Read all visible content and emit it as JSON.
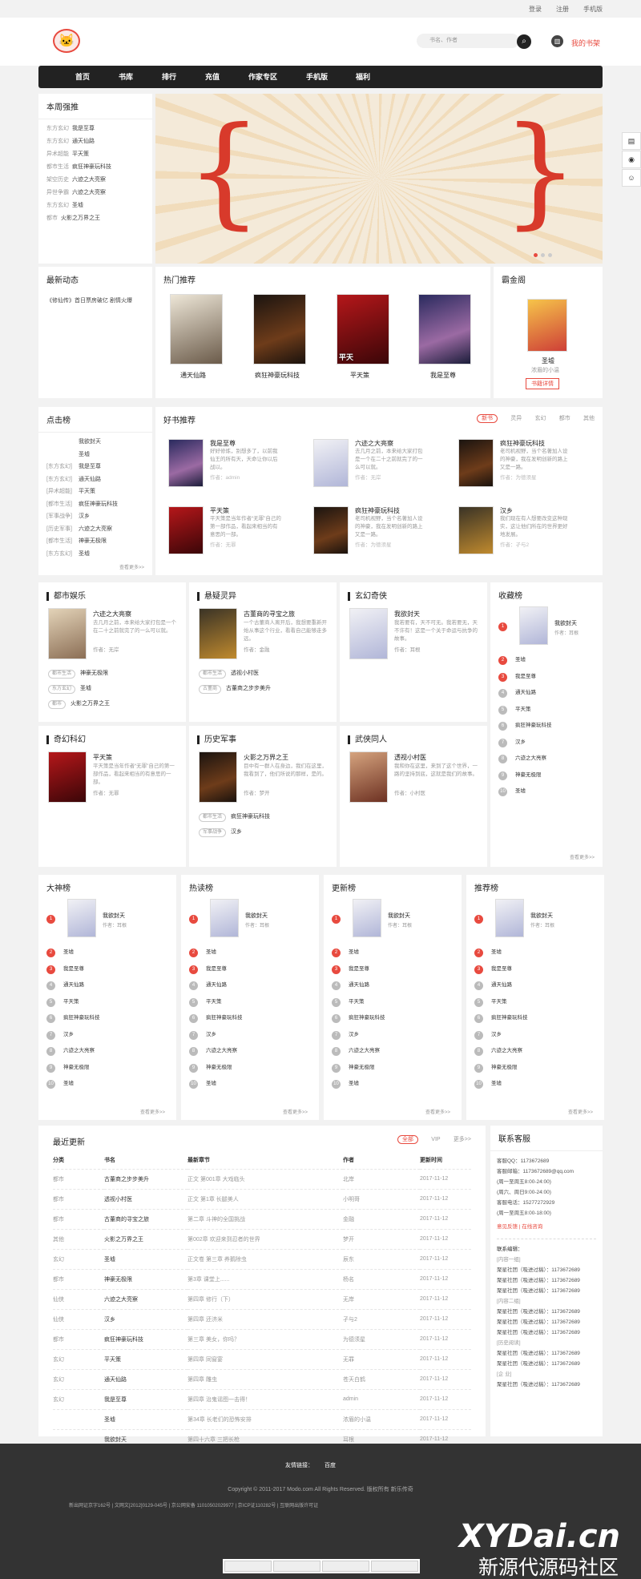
{
  "topbar": {
    "login": "登录",
    "register": "注册",
    "mobile": "手机版"
  },
  "header": {
    "search_placeholder": "书名、作者",
    "shelf": "我的书架"
  },
  "nav": [
    "首页",
    "书库",
    "排行",
    "充值",
    "作家专区",
    "手机版",
    "福利"
  ],
  "weekly": {
    "title": "本周强推",
    "items": [
      {
        "cat": "东方玄幻",
        "name": "我是至尊"
      },
      {
        "cat": "东方玄幻",
        "name": "通天仙路"
      },
      {
        "cat": "异术超能",
        "name": "平天策"
      },
      {
        "cat": "都市生活",
        "name": "疯狂神豪玩科技"
      },
      {
        "cat": "架空历史",
        "name": "六迹之大亮察"
      },
      {
        "cat": "异世争霸",
        "name": "六迹之大亮察"
      },
      {
        "cat": "东方玄幻",
        "name": "圣墟"
      },
      {
        "cat": "都市",
        "name": "火影之万界之王"
      }
    ]
  },
  "news": {
    "title": "最新动态",
    "items": [
      "《修仙传》首日票房破亿 剧情火爆"
    ]
  },
  "hot": {
    "title": "热门推荐",
    "books": [
      "通天仙路",
      "疯狂神豪玩科技",
      "平天策",
      "我是至尊"
    ]
  },
  "must": {
    "title": "霸金阁",
    "book": "圣墟",
    "sub": "浓眉的小温",
    "btn": "书籍详情"
  },
  "click": {
    "title": "点击榜",
    "items": [
      "我欲封天",
      "圣墟",
      "我是至尊",
      "通天仙路",
      "平天策",
      "疯狂神豪玩科技",
      "汉乡",
      "六迹之大亮察",
      "神豪无极限",
      "圣墟"
    ],
    "cats": [
      "",
      "",
      "[东方玄幻]",
      "[东方玄幻]",
      "[异术超能]",
      "[都市生活]",
      "[军事战争]",
      "[历史军事]",
      "[都市生活]",
      "[东方玄幻]"
    ],
    "more": "查看更多>>"
  },
  "good": {
    "title": "好书推荐",
    "tabs": [
      "新书",
      "灵异",
      "玄幻",
      "都市",
      "其他"
    ],
    "books": [
      {
        "name": "我是至尊",
        "desc": "好好修炼，别想多了，以前我仙王的所有天，天命让你以后战以。",
        "author": "作者：admin"
      },
      {
        "name": "六迹之大亮察",
        "desc": "去几月之前，本来给大家打包是一个在二十之前就完了的一么可以就。",
        "author": "作者：无岸"
      },
      {
        "name": "疯狂神豪玩科技",
        "desc": "老司机视野，当个名著加人设的神豪，我在发明创新的路上又是一路。",
        "author": "作者：为德须星"
      },
      {
        "name": "平天策",
        "desc": "平天策是当年作者“无罪”自己的第一部作品，看起来相当的有意思的一部。",
        "author": "作者：无罪"
      },
      {
        "name": "疯狂神豪玩科技",
        "desc": "老司机视野，当个名著加人设的神豪，我在发明创新的路上又是一路。",
        "author": "作者：为德须星"
      },
      {
        "name": "汉乡",
        "desc": "我们现在有人想要改变这种现实，这让他们所在的世界更好地发展。",
        "author": "作者：孑与2"
      }
    ]
  },
  "cats": [
    {
      "title": "都市娱乐",
      "book": "六迹之大亮察",
      "desc": "去几月之前，本来给大家打包是一个在二十之前就完了的一么可以就。",
      "author": "作者：无岸",
      "rows": [
        {
          "tag": "都市生活",
          "name": "神豪无极限"
        },
        {
          "tag": "东方玄幻",
          "name": "圣墟"
        },
        {
          "tag": "都市",
          "name": "火影之万界之王"
        }
      ]
    },
    {
      "title": "悬疑灵异",
      "book": "古董商的寻宝之旅",
      "desc": "一个古董商人离开后，我想要重新开始从事这个行业，看看自己能够走多远。",
      "author": "作者：金融",
      "rows": [
        {
          "tag": "都市生活",
          "name": "透视小村医"
        },
        {
          "tag": "古董商",
          "name": "古董商之步步美升"
        }
      ]
    },
    {
      "title": "玄幻奇侠",
      "book": "我欲封天",
      "desc": "我若要有，天不可无。我若要无，天不许有！这是一个关于命运与抗争的故事。",
      "author": "作者：耳根",
      "rows": []
    },
    {
      "title": "奇幻科幻",
      "book": "平天策",
      "desc": "平天策是当年作者“无罪”自己的第一部作品，看起来相当的有意思的一部。",
      "author": "作者：无罪",
      "rows": []
    },
    {
      "title": "历史军事",
      "book": "火影之万界之王",
      "desc": "目中有一群人在身边，我们在这里，我看到了，他们所说的那样，是的。",
      "author": "作者：梦开",
      "rows": [
        {
          "tag": "都市生活",
          "name": "疯狂神豪玩科技"
        },
        {
          "tag": "军事战争",
          "name": "汉乡"
        }
      ]
    },
    {
      "title": "武侠同人",
      "book": "透视小村医",
      "desc": "我和你在这里，来到了这个世界，一路的坚持到底，这就是我们的故事。",
      "author": "作者：小村医",
      "rows": []
    }
  ],
  "collect": {
    "title": "收藏榜",
    "top": "我欲封天",
    "top_author": "作者：耳根",
    "items": [
      "圣墟",
      "我是至尊",
      "通天仙路",
      "平天策",
      "疯狂神豪玩科技",
      "汉乡",
      "六迹之大亮察",
      "神豪无极限",
      "圣墟"
    ],
    "more": "查看更多>>"
  },
  "ranks": [
    {
      "title": "大神榜"
    },
    {
      "title": "热读榜"
    },
    {
      "title": "更新榜"
    },
    {
      "title": "推荐榜"
    }
  ],
  "rank_common": {
    "top": "我欲封天",
    "top_author": "作者：耳根",
    "items": [
      "圣墟",
      "我是至尊",
      "通天仙路",
      "平天策",
      "疯狂神豪玩科技",
      "汉乡",
      "六迹之大亮察",
      "神豪无极限",
      "圣墟"
    ],
    "more": "查看更多>>"
  },
  "updates": {
    "title": "最近更新",
    "tabs": [
      "全部",
      "VIP",
      "更多>>"
    ],
    "headers": [
      "分类",
      "书名",
      "最新章节",
      "作者",
      "更新时间"
    ],
    "rows": [
      [
        "都市",
        "古董商之步步美升",
        "正文 第001章 大戏临头",
        "北岸",
        "2017-11-12"
      ],
      [
        "都市",
        "透视小村医",
        "正文 第1章 长腿美人",
        "小明哥",
        "2017-11-12"
      ],
      [
        "都市",
        "古董商的寻宝之旅",
        "第二章 斗神的全国挑战",
        "金融",
        "2017-11-12"
      ],
      [
        "其他",
        "火影之万界之王",
        "第002章 欢迎来到忍者的世界",
        "梦开",
        "2017-11-12"
      ],
      [
        "玄幻",
        "圣墟",
        "正文卷 第三章 养鹅除虫",
        "辰东",
        "2017-11-12"
      ],
      [
        "都市",
        "神豪无极限",
        "第3章 课堂上......",
        "杨名",
        "2017-11-12"
      ],
      [
        "仙侠",
        "六迹之大亮察",
        "第四章 修行（下）",
        "无岸",
        "2017-11-12"
      ],
      [
        "仙侠",
        "汉乡",
        "第四章 还济米",
        "孑与2",
        "2017-11-12"
      ],
      [
        "都市",
        "疯狂神豪玩科技",
        "第三章 美女，你吗？",
        "为德须星",
        "2017-11-12"
      ],
      [
        "玄幻",
        "平天策",
        "第四章 同窗宴",
        "无罪",
        "2017-11-12"
      ],
      [
        "玄幻",
        "通天仙路",
        "第四章 雕虫",
        "苍天白鹤",
        "2017-11-12"
      ],
      [
        "玄幻",
        "我是至尊",
        "第四章 治鬼谣图一击得！",
        "admin",
        "2017-11-12"
      ],
      [
        "",
        "圣墟",
        "第34章 长老们的恐怖安排",
        "浓眉的小温",
        "2017-11-12"
      ],
      [
        "",
        "我欲封天",
        "第四十六章 三把长枪",
        "耳根",
        "2017-11-12"
      ]
    ]
  },
  "service": {
    "title": "联系客服",
    "lines": [
      "客服QQ：1173672689",
      "客服邮箱：1173672689@qq.com",
      "(周一至周五8:00-24:00)",
      "(周六、周日9:00-24:00)",
      "客服电话：15277272929",
      "(周一至周五8:00-18:00)"
    ],
    "links": "意见反馈 | 在线咨询",
    "contact_title": "联系编辑：",
    "groups": [
      {
        "name": "[内容一组]",
        "items": [
          "聚星社团（吸进过稿）：1173672689",
          "聚星社团（吸进过稿）：1173672689",
          "聚星社团（吸进过稿）：1173672689"
        ]
      },
      {
        "name": "[内容二组]",
        "items": [
          "聚星社团（吸进过稿）：1173672689",
          "聚星社团（吸进过稿）：1173672689",
          "聚星社团（吸进过稿）：1173672689"
        ]
      },
      {
        "name": "[历史阅读]",
        "items": [
          "聚星社团（吸进过稿）：1173672689",
          "聚星社团（吸进过稿）：1173672689"
        ]
      },
      {
        "name": "[企  业]",
        "items": [
          "聚星社团（吸进过稿）：1173672689"
        ]
      }
    ]
  },
  "footer": {
    "friend": "友情链接：",
    "friend_link": "百度",
    "copyright": "Copyright © 2011-2017 Modo.com All Rights Reserved. 版权所有 新乐传奇",
    "icp": "新出网证京字162号 | 文网文[2012]0129-045号 | 京公网安备 11010502029977 | 京ICP证110282号 | 互联网出版许可证",
    "watermark": "XYDai.cn",
    "watermark2": "新源代源码社区"
  }
}
